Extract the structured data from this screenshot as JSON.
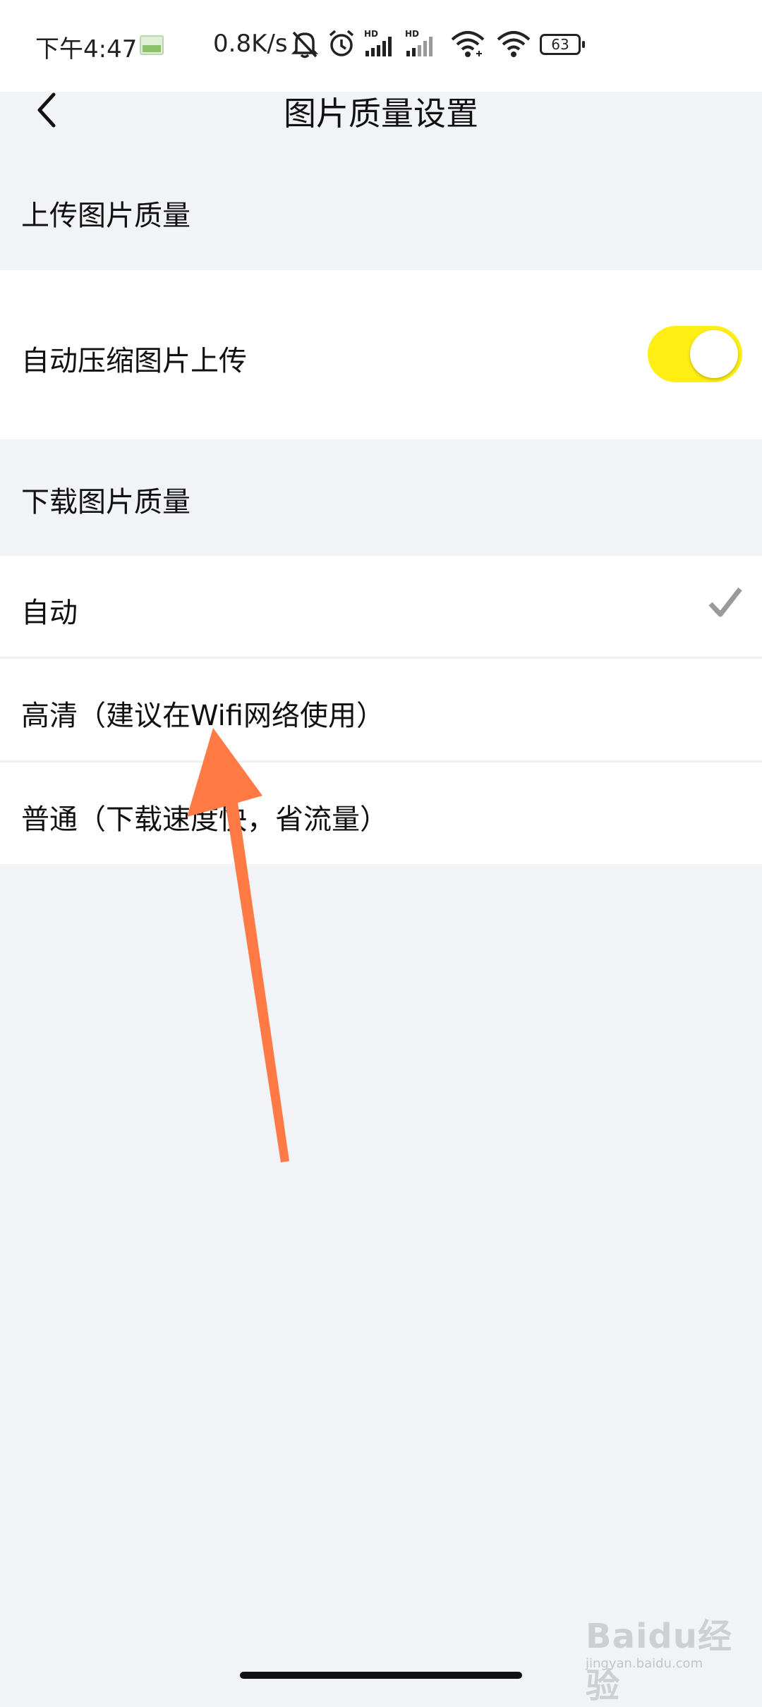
{
  "status_bar": {
    "time": "下午4:47",
    "network_speed": "0.8K/s",
    "battery_level": "63",
    "icons": [
      "gallery-notification-icon",
      "mute-bell-icon",
      "alarm-icon",
      "hd-signal-icon",
      "hd-signal-icon",
      "wifi-icon",
      "wifi-icon",
      "battery-icon"
    ]
  },
  "header": {
    "back_icon": "chevron-left-icon",
    "title": "图片质量设置"
  },
  "upload_section": {
    "title": "上传图片质量",
    "auto_compress": {
      "label": "自动压缩图片上传",
      "enabled": true,
      "toggle_color": "#ffee14"
    }
  },
  "download_section": {
    "title": "下载图片质量",
    "options": [
      {
        "label": "自动",
        "selected": true
      },
      {
        "label": "高清（建议在Wifi网络使用）",
        "selected": false
      },
      {
        "label": "普通（下载速度快，省流量）",
        "selected": false
      }
    ],
    "check_color": "#9a9a9a"
  },
  "annotation": {
    "arrow_color": "#ff7a45"
  },
  "watermark": {
    "text": "Baidu经验",
    "url": "jingyan.baidu.com"
  }
}
